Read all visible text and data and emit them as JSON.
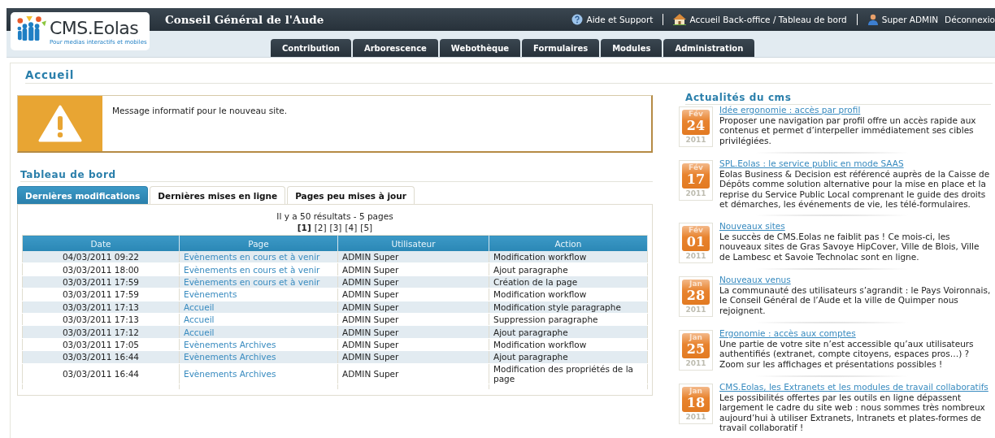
{
  "header": {
    "logo_text": "CMS.Eolas",
    "logo_tagline": "Pour medias interactifs et mobiles",
    "site_title": "Conseil Général de l'Aude",
    "links": [
      {
        "kind": "help",
        "label": "Aide et Support"
      },
      {
        "kind": "home",
        "label": "Accueil Back-office / Tableau de bord"
      },
      {
        "kind": "user",
        "label": "Super ADMIN"
      },
      {
        "kind": "plain",
        "label": "Déconnexio"
      }
    ]
  },
  "nav_tabs": [
    "Contribution",
    "Arborescence",
    "Webothèque",
    "Formulaires",
    "Modules",
    "Administration"
  ],
  "page_title": "Accueil",
  "alert": {
    "message": "Message informatif pour le nouveau site."
  },
  "dashboard": {
    "title": "Tableau de bord",
    "tabs": [
      {
        "label": "Dernières modifications",
        "selected": true
      },
      {
        "label": "Dernières mises en ligne",
        "selected": false
      },
      {
        "label": "Pages peu mises à jour",
        "selected": false
      }
    ],
    "summary": "Il y a 50 résultats - 5 pages",
    "pages": [
      {
        "label": "[1]",
        "selected": true
      },
      {
        "label": "[2]",
        "selected": false
      },
      {
        "label": "[3]",
        "selected": false
      },
      {
        "label": "[4]",
        "selected": false
      },
      {
        "label": "[5]",
        "selected": false
      }
    ],
    "columns": [
      "Date",
      "Page",
      "Utilisateur",
      "Action"
    ],
    "rows": [
      {
        "date": "04/03/2011 09:22",
        "page": "Evènements en cours et à venir",
        "user": "ADMIN Super",
        "action": "Modification workflow"
      },
      {
        "date": "03/03/2011 18:00",
        "page": "Evènements en cours et à venir",
        "user": "ADMIN Super",
        "action": "Ajout paragraphe"
      },
      {
        "date": "03/03/2011 17:59",
        "page": "Evènements en cours et à venir",
        "user": "ADMIN Super",
        "action": "Création de la page"
      },
      {
        "date": "03/03/2011 17:59",
        "page": "Evènements",
        "user": "ADMIN Super",
        "action": "Modification workflow"
      },
      {
        "date": "03/03/2011 17:13",
        "page": "Accueil",
        "user": "ADMIN Super",
        "action": "Modification style paragraphe"
      },
      {
        "date": "03/03/2011 17:13",
        "page": "Accueil",
        "user": "ADMIN Super",
        "action": "Suppression paragraphe"
      },
      {
        "date": "03/03/2011 17:12",
        "page": "Accueil",
        "user": "ADMIN Super",
        "action": "Ajout paragraphe"
      },
      {
        "date": "03/03/2011 17:05",
        "page": "Evènements Archives",
        "user": "ADMIN Super",
        "action": "Modification workflow"
      },
      {
        "date": "03/03/2011 16:44",
        "page": "Evènements Archives",
        "user": "ADMIN Super",
        "action": "Ajout paragraphe"
      },
      {
        "date": "03/03/2011 16:44",
        "page": "Evènements Archives",
        "user": "ADMIN Super",
        "action": "Modification des propriétés de la page"
      }
    ]
  },
  "news": {
    "title": "Actualités du cms",
    "items": [
      {
        "month": "Fév",
        "day": "24",
        "year": "2011",
        "title": "Idée ergonomie : accès par profil",
        "text": "Proposer une navigation par profil offre un accès rapide aux contenus et permet d’interpeller immédiatement ses cibles privilégiées."
      },
      {
        "month": "Fév",
        "day": "17",
        "year": "2011",
        "title": "SPL.Eolas : le service public en mode SAAS",
        "text": "Eolas Business & Decision est référencé auprès de la Caisse de Dépôts comme solution alternative pour la mise en place et la reprise du Service Public Local comprenant le guide des droits et démarches, les événements de vie, les télé-formulaires."
      },
      {
        "month": "Fév",
        "day": "01",
        "year": "2011",
        "title": "Nouveaux sites",
        "text": "Le succès de CMS.Eolas ne faiblit pas ! Ce mois-ci, les nouveaux sites de Gras Savoye HipCover, Ville de Blois, Ville de Lambesc et Savoie Technolac sont en ligne."
      },
      {
        "month": "Jan",
        "day": "28",
        "year": "2011",
        "title": "Nouveaux venus",
        "text": "La communauté des utilisateurs s’agrandit : le Pays Voironnais, le Conseil Général de l’Aude et la ville de Quimper nous rejoignent."
      },
      {
        "month": "Jan",
        "day": "25",
        "year": "2011",
        "title": "Ergonomie : accès aux comptes",
        "text": "Une partie de votre site n’est accessible qu’aux utilisateurs authentifiés (extranet, compte citoyens, espaces pros…) ? Zoom sur les affichages et présentations possibles !"
      },
      {
        "month": "Jan",
        "day": "18",
        "year": "2011",
        "title": "CMS.Eolas, les Extranets et les modules de travail collaboratifs",
        "text": "Les possibilités offertes par les outils en ligne dépassent largement le cadre du site web : nous sommes très nombreux aujourd’hui à utiliser Extranets, Intranets et plates-formes de travail collaboratif !"
      }
    ]
  }
}
